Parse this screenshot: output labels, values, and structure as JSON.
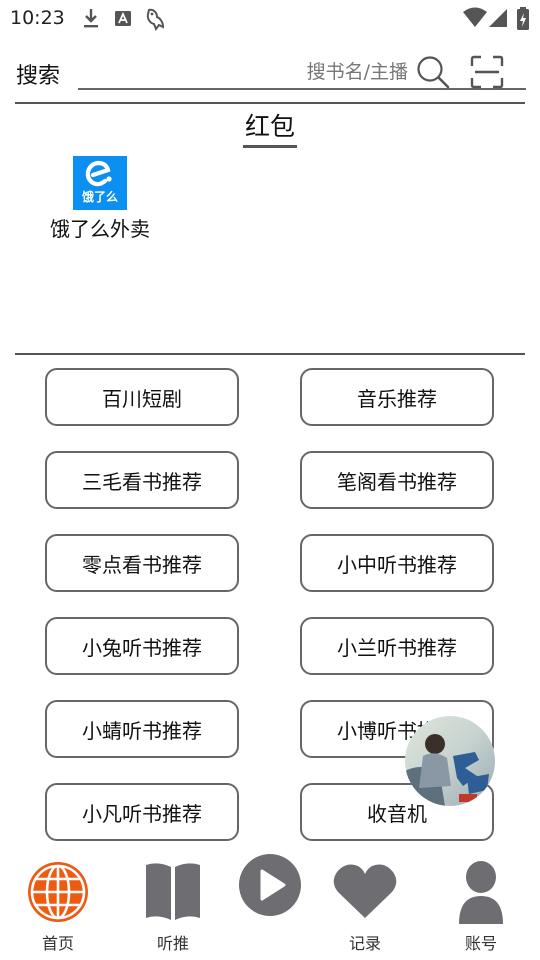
{
  "status_bar": {
    "time": "10:23"
  },
  "search": {
    "label": "搜索",
    "placeholder": "搜书名/主播"
  },
  "red_packet": {
    "title": "红包",
    "apps": [
      {
        "name": "饿了么外卖",
        "logo_text": "饿了么",
        "brand_color": "#0b8ff0"
      }
    ]
  },
  "recommendations": [
    "百川短剧",
    "音乐推荐",
    "三毛看书推荐",
    "笔阁看书推荐",
    "零点看书推荐",
    "小中听书推荐",
    "小兔听书推荐",
    "小兰听书推荐",
    "小蜻听书推荐",
    "小博听书推荐",
    "小凡听书推荐",
    "收音机"
  ],
  "bottom_nav": [
    {
      "label": "首页",
      "icon": "globe-icon",
      "active": true
    },
    {
      "label": "听推",
      "icon": "book-icon"
    },
    {
      "label": "",
      "icon": "play-icon"
    },
    {
      "label": "记录",
      "icon": "heart-icon"
    },
    {
      "label": "账号",
      "icon": "person-icon"
    }
  ],
  "colors": {
    "active_nav": "#ee5a12",
    "inactive_nav": "#6e6e72",
    "border": "#666666"
  }
}
